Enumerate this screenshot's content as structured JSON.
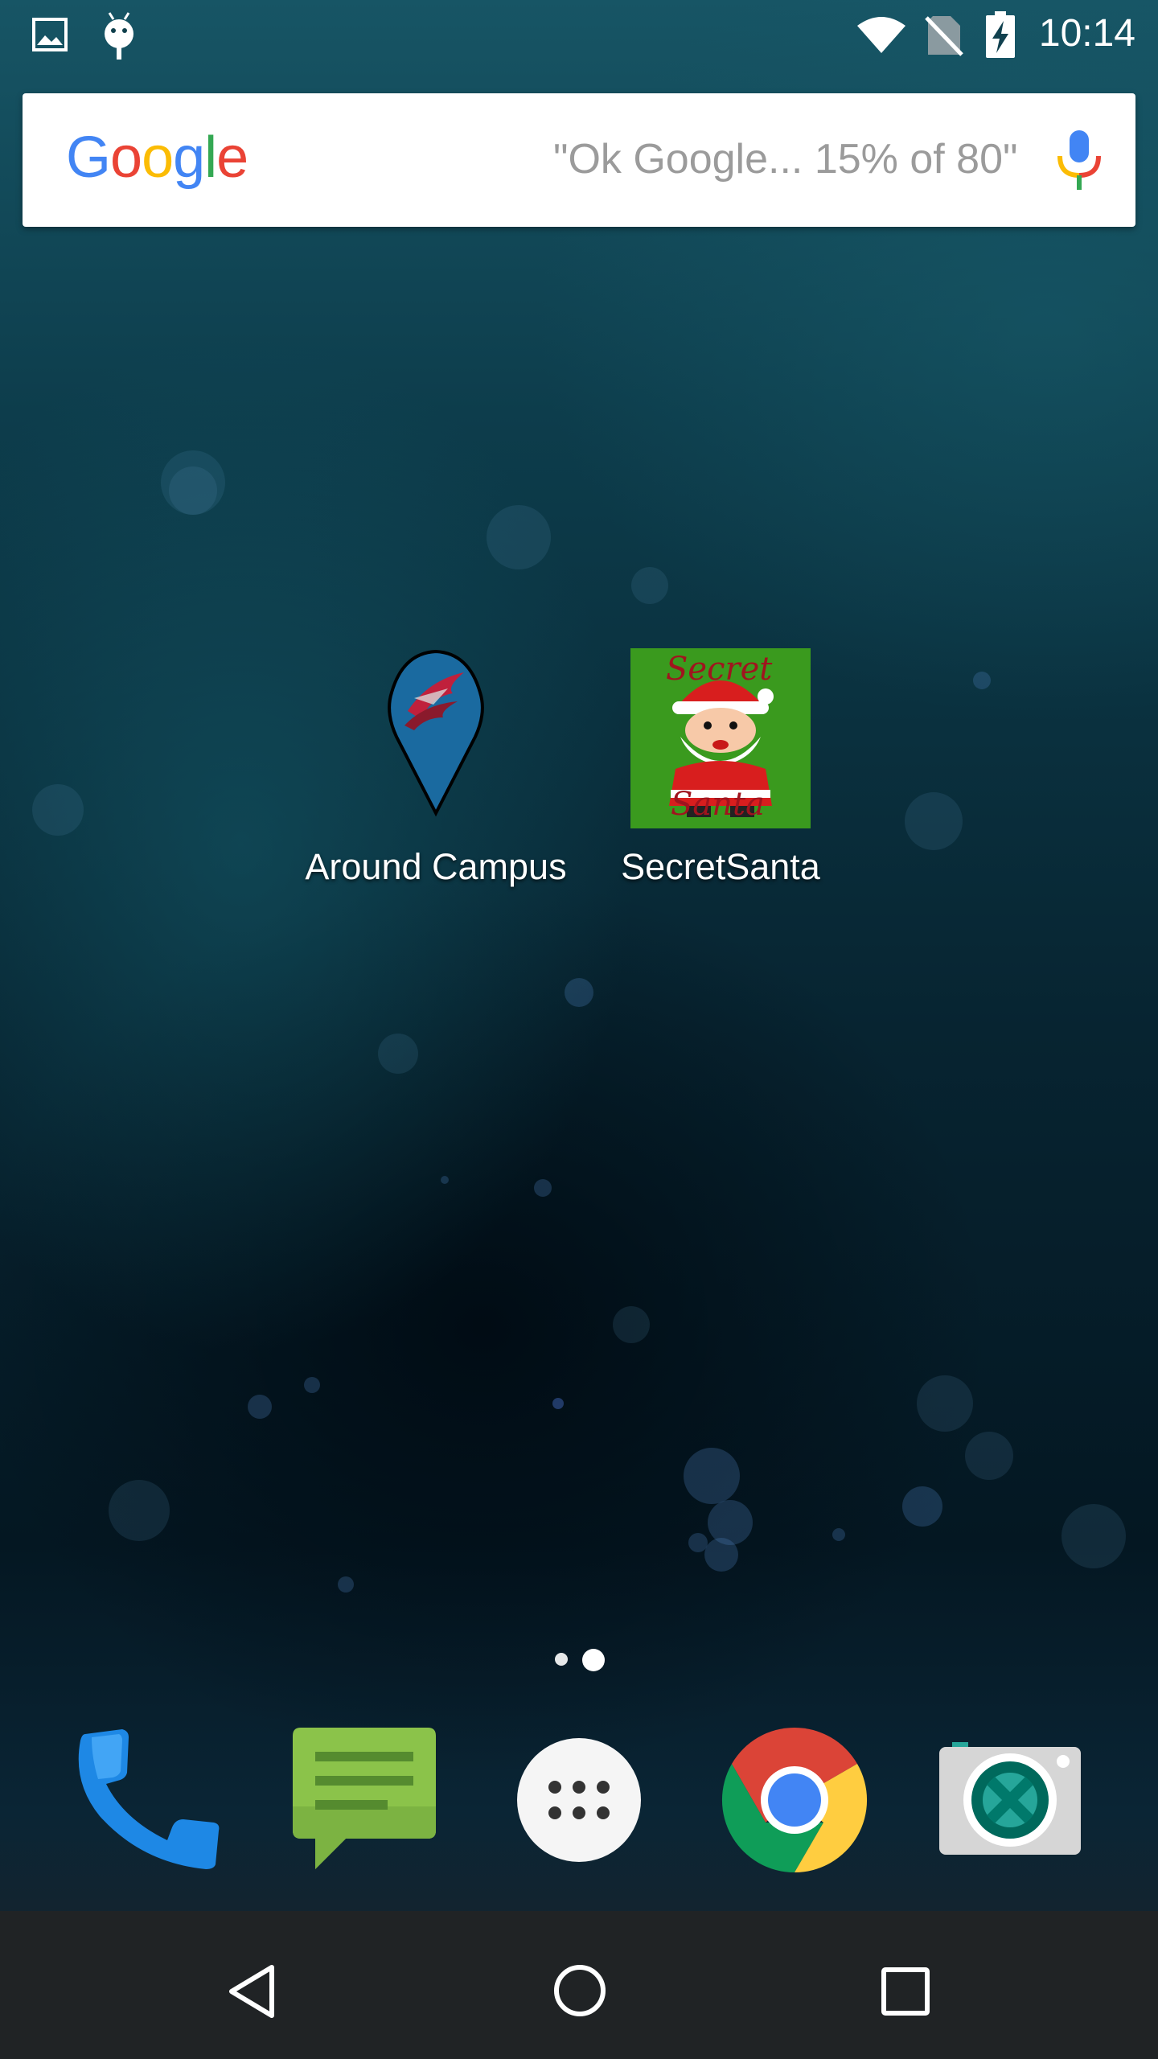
{
  "status_bar": {
    "time": "10:14",
    "left_icons": [
      "image-notification-icon",
      "android-debug-icon"
    ],
    "right_icons": [
      "wifi-icon",
      "no-sim-icon",
      "battery-charging-icon"
    ]
  },
  "search": {
    "logo_letters": [
      {
        "char": "G",
        "color": "#4285F4"
      },
      {
        "char": "o",
        "color": "#EA4335"
      },
      {
        "char": "o",
        "color": "#FBBC05"
      },
      {
        "char": "g",
        "color": "#4285F4"
      },
      {
        "char": "l",
        "color": "#34A853"
      },
      {
        "char": "e",
        "color": "#EA4335"
      }
    ],
    "hint": "\"Ok Google... 15% of 80\"",
    "mic_icon": "mic-icon"
  },
  "apps": [
    {
      "label": "Around Campus",
      "icon": "map-pin-icon"
    },
    {
      "label": "SecretSanta",
      "icon": "secret-santa-icon",
      "icon_text_top": "Secret",
      "icon_text_bottom": "Santa"
    }
  ],
  "page_indicator": {
    "pages": 2,
    "current": 2
  },
  "dock": [
    {
      "name": "phone",
      "icon": "phone-icon"
    },
    {
      "name": "messages",
      "icon": "messages-icon"
    },
    {
      "name": "app-drawer",
      "icon": "app-drawer-icon"
    },
    {
      "name": "chrome",
      "icon": "chrome-icon"
    },
    {
      "name": "camera",
      "icon": "camera-icon"
    }
  ],
  "nav": [
    "back-icon",
    "home-icon",
    "recents-icon"
  ],
  "colors": {
    "google_blue": "#4285F4",
    "google_red": "#EA4335",
    "google_yellow": "#FBBC05",
    "google_green": "#34A853",
    "phone_blue": "#1E88E5",
    "messages_green": "#8BC34A",
    "santa_green": "#3A9A1E"
  }
}
